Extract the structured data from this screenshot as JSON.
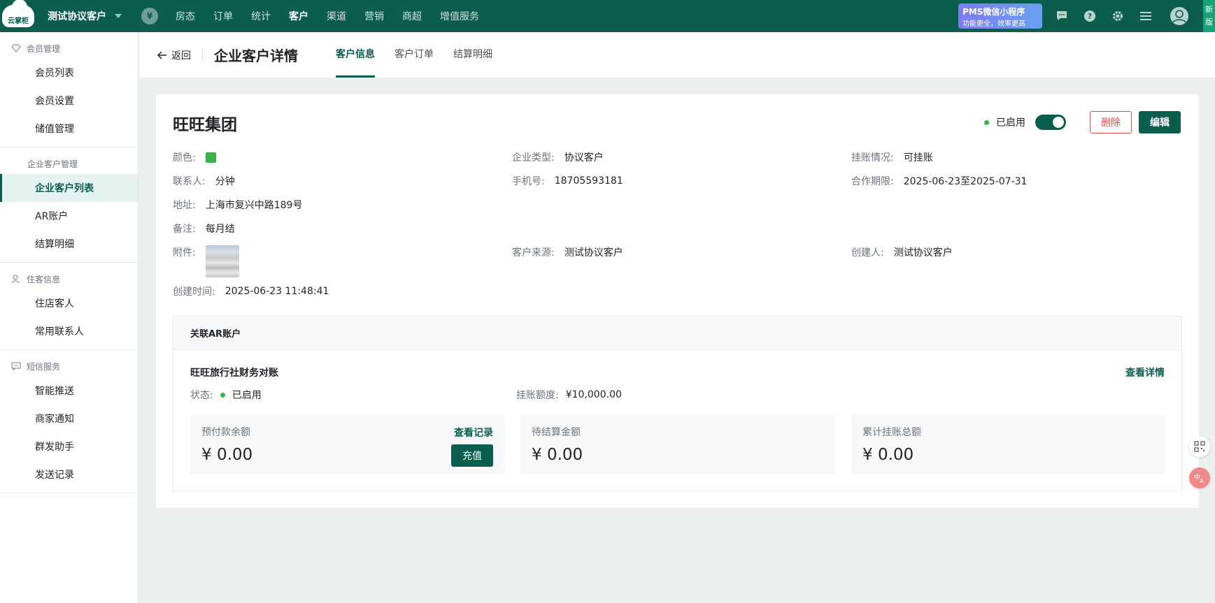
{
  "topbar": {
    "logo_text": "云掌柜",
    "hotel_name": "测试协议客户",
    "nav": [
      "房态",
      "订单",
      "统计",
      "客户",
      "渠道",
      "营销",
      "商超",
      "增值服务"
    ],
    "nav_active": 3,
    "promo_line1": "PMS微信小程序",
    "promo_line2": "功能更全，效率更高",
    "new_badge": "新版"
  },
  "sidebar": {
    "groups": [
      {
        "title": "会员管理",
        "icon": "member-icon",
        "items": [
          "会员列表",
          "会员设置",
          "储值管理"
        ]
      },
      {
        "title": "企业客户管理",
        "icon": "",
        "items": [
          "企业客户列表",
          "AR账户",
          "结算明细"
        ]
      },
      {
        "title": "住客信息",
        "icon": "user-icon",
        "items": [
          "住店客人",
          "常用联系人"
        ]
      },
      {
        "title": "短信服务",
        "icon": "message-icon",
        "items": [
          "智能推送",
          "商家通知",
          "群发助手",
          "发送记录"
        ]
      }
    ]
  },
  "header": {
    "back_label": "返回",
    "title": "企业客户详情",
    "tabs": [
      "客户信息",
      "客户订单",
      "结算明细"
    ],
    "active_tab": 0
  },
  "customer": {
    "name": "旺旺集团",
    "status": "已启用",
    "delete_label": "删除",
    "edit_label": "编辑",
    "color_label": "颜色:",
    "color_value": "#37b34a",
    "type_label": "企业类型:",
    "type_value": "协议客户",
    "credit_label": "挂账情况:",
    "credit_value": "可挂账",
    "contact_label": "联系人:",
    "contact_value": "分钟",
    "phone_label": "手机号:",
    "phone_value": "18705593181",
    "period_label": "合作期限:",
    "period_value": "2025-06-23至2025-07-31",
    "address_label": "地址:",
    "address_value": "上海市复兴中路189号",
    "remark_label": "备注:",
    "remark_value": "每月结",
    "attach_label": "附件:",
    "source_label": "客户来源:",
    "source_value": "测试协议客户",
    "creator_label": "创建人:",
    "creator_value": "测试协议客户",
    "created_label": "创建时间:",
    "created_value": "2025-06-23 11:48:41"
  },
  "ar": {
    "section_title": "关联AR账户",
    "account_name": "旺旺旅行社财务对账",
    "detail_link": "查看详情",
    "status_label": "状态:",
    "status_value": "已启用",
    "limit_label": "挂账额度:",
    "limit_value": "¥10,000.00",
    "stats": [
      {
        "title": "预付款余额",
        "value": "¥ 0.00",
        "link": "查看记录",
        "button": "充值"
      },
      {
        "title": "待结算金额",
        "value": "¥ 0.00"
      },
      {
        "title": "累计挂账总额",
        "value": "¥ 0.00"
      }
    ]
  }
}
